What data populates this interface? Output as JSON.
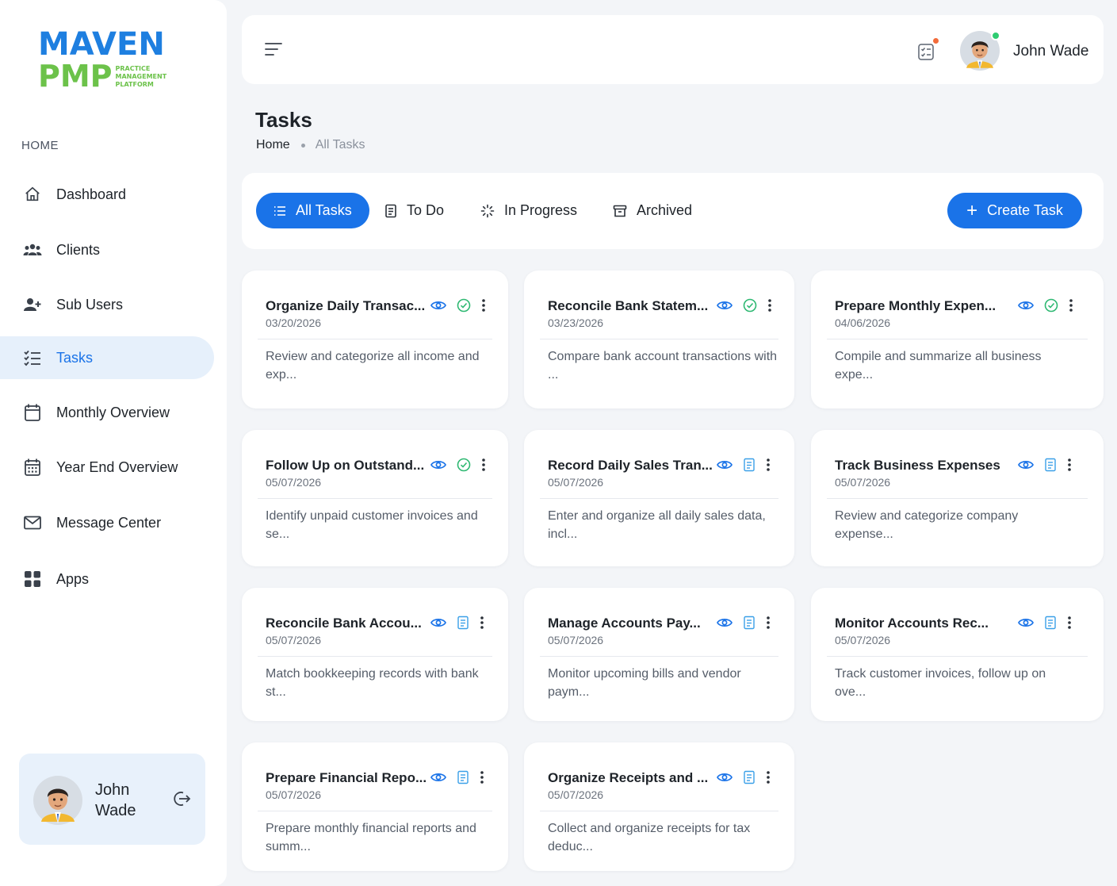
{
  "brand": {
    "name_top": "MAVEN",
    "name_bottom": "PMP",
    "tagline": [
      "PRACTICE",
      "MANAGEMENT",
      "PLATFORM"
    ]
  },
  "sidebar": {
    "section_label": "HOME",
    "items": [
      {
        "label": "Dashboard",
        "icon": "home-icon",
        "active": false
      },
      {
        "label": "Clients",
        "icon": "users-group-icon",
        "active": false
      },
      {
        "label": "Sub Users",
        "icon": "user-plus-icon",
        "active": false
      },
      {
        "label": "Tasks",
        "icon": "task-list-icon",
        "active": true
      },
      {
        "label": "Monthly Overview",
        "icon": "calendar-icon",
        "active": false
      },
      {
        "label": "Year End Overview",
        "icon": "calendar-grid-icon",
        "active": false
      },
      {
        "label": "Message Center",
        "icon": "mail-icon",
        "active": false
      },
      {
        "label": "Apps",
        "icon": "apps-grid-icon",
        "active": false
      }
    ],
    "user_card": {
      "first": "John",
      "last": "Wade"
    }
  },
  "header": {
    "user_name": "John Wade"
  },
  "page": {
    "title": "Tasks",
    "breadcrumb_home": "Home",
    "breadcrumb_current": "All Tasks"
  },
  "tabs": [
    {
      "label": "All Tasks",
      "icon": "list-icon",
      "active": true
    },
    {
      "label": "To Do",
      "icon": "document-icon",
      "active": false
    },
    {
      "label": "In Progress",
      "icon": "loader-icon",
      "active": false
    },
    {
      "label": "Archived",
      "icon": "archive-icon",
      "active": false
    }
  ],
  "create_button": "Create Task",
  "colors": {
    "accent": "#1a73e8",
    "status_done": "#2eb872",
    "status_todo": "#3aa0e8",
    "eye": "#1a73e8"
  },
  "tasks": [
    {
      "title": "Organize Daily Transac...",
      "date": "03/20/2026",
      "desc": "Review and categorize all income and exp...",
      "status": "completed"
    },
    {
      "title": "Reconcile Bank Statem...",
      "date": "03/23/2026",
      "desc": "Compare bank account transactions with ...",
      "status": "completed"
    },
    {
      "title": "Prepare Monthly Expen...",
      "date": "04/06/2026",
      "desc": "Compile and summarize all business expe...",
      "status": "completed"
    },
    {
      "title": "Follow Up on Outstand...",
      "date": "05/07/2026",
      "desc": "Identify unpaid customer invoices and se...",
      "status": "completed"
    },
    {
      "title": "Record Daily Sales Tran...",
      "date": "05/07/2026",
      "desc": "Enter and organize all daily sales data, incl...",
      "status": "todo"
    },
    {
      "title": "Track Business Expenses",
      "date": "05/07/2026",
      "desc": "Review and categorize company expense...",
      "status": "todo"
    },
    {
      "title": "Reconcile Bank Accou...",
      "date": "05/07/2026",
      "desc": "Match bookkeeping records with bank st...",
      "status": "todo"
    },
    {
      "title": "Manage Accounts Pay...",
      "date": "05/07/2026",
      "desc": "Monitor upcoming bills and vendor paym...",
      "status": "todo"
    },
    {
      "title": "Monitor Accounts Rec...",
      "date": "05/07/2026",
      "desc": "Track customer invoices, follow up on ove...",
      "status": "todo"
    },
    {
      "title": "Prepare Financial Repo...",
      "date": "05/07/2026",
      "desc": "Prepare monthly financial reports and summ...",
      "status": "todo"
    },
    {
      "title": "Organize Receipts and ...",
      "date": "05/07/2026",
      "desc": "Collect and organize receipts for tax deduc...",
      "status": "todo"
    }
  ]
}
